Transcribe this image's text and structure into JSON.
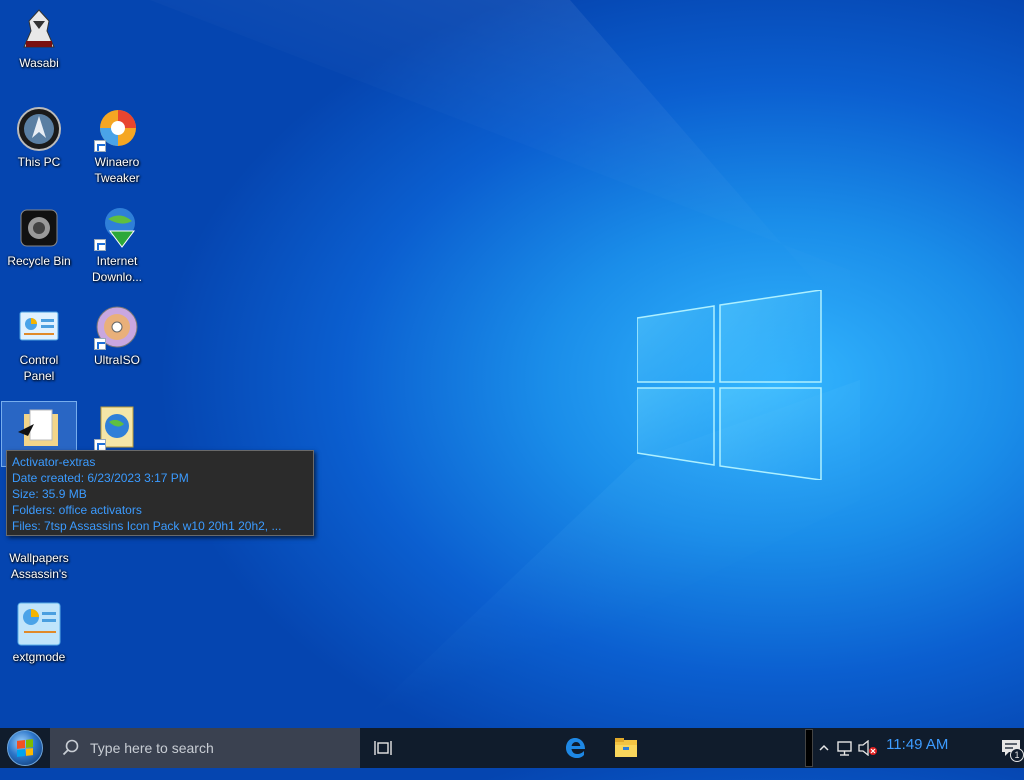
{
  "desktop": {
    "icons": [
      {
        "label": "Wasabi",
        "icon": "assassin-figure-icon"
      },
      {
        "label": "This PC",
        "icon": "assassin-emblem-icon"
      },
      {
        "label": "Winaero Tweaker",
        "icon": "winaero-tweaker-icon"
      },
      {
        "label": "Recycle Bin",
        "icon": "recycle-bin-icon"
      },
      {
        "label": "Internet Downlo...",
        "icon": "internet-download-manager-icon"
      },
      {
        "label": "Control Panel",
        "icon": "control-panel-icon"
      },
      {
        "label": "UltraISO",
        "icon": "ultraiso-disc-icon"
      },
      {
        "label": "Activator-extras",
        "icon": "folder-icon"
      },
      {
        "label": "",
        "icon": "globe-document-icon"
      },
      {
        "label": "Wallpapers Assassin's",
        "icon": "folder-icon"
      },
      {
        "label": "extgmode",
        "icon": "extgmode-icon"
      }
    ]
  },
  "tooltip": {
    "name": "Activator-extras",
    "date_created": "Date created: 6/23/2023 3:17 PM",
    "size": "Size: 35.9 MB",
    "folders": "Folders: office activators",
    "files": "Files: 7tsp Assassins Icon Pack w10 20h1 20h2, ..."
  },
  "taskbar": {
    "search_placeholder": "Type here to search",
    "clock": "11:49 AM",
    "notification_count": "1",
    "pinned": [
      "edge-icon",
      "file-explorer-icon"
    ],
    "tray": [
      "chevron-up-icon",
      "network-icon",
      "volume-muted-icon"
    ]
  },
  "colors": {
    "accent": "#3d9cff",
    "taskbar": "#101c2c",
    "search_bg": "#3a4150"
  }
}
